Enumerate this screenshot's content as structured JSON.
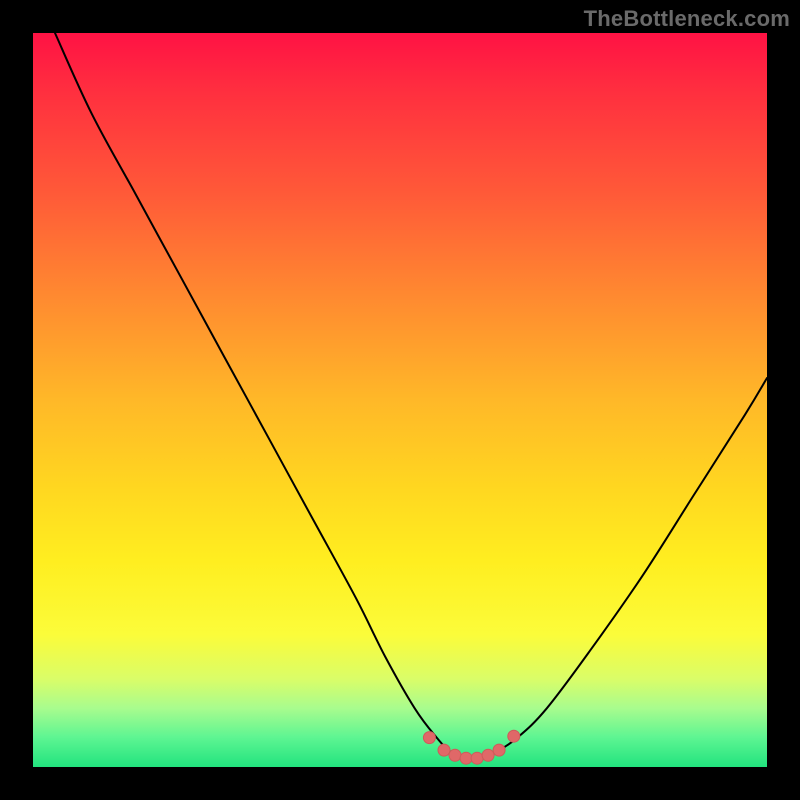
{
  "watermark": "TheBottleneck.com",
  "colors": {
    "curve": "#000000",
    "marker_fill": "#e06868",
    "marker_stroke": "#cf5a5a",
    "gradient_top": "#ff1244",
    "gradient_bottom": "#22e37e",
    "frame": "#000000"
  },
  "chart_data": {
    "type": "line",
    "title": "",
    "xlabel": "",
    "ylabel": "",
    "xlim": [
      0,
      100
    ],
    "ylim": [
      0,
      100
    ],
    "grid": false,
    "legend": null,
    "series": [
      {
        "name": "bottleneck-curve",
        "x": [
          3,
          8,
          14,
          20,
          26,
          32,
          38,
          44,
          48,
          52,
          55,
          57,
          59,
          61,
          63,
          66,
          70,
          76,
          83,
          90,
          97,
          100
        ],
        "y": [
          100,
          89,
          78,
          67,
          56,
          45,
          34,
          23,
          15,
          8,
          4,
          2,
          1.2,
          1.2,
          2,
          4,
          8,
          16,
          26,
          37,
          48,
          53
        ]
      }
    ],
    "markers": {
      "name": "trough-markers",
      "x": [
        54,
        56,
        57.5,
        59,
        60.5,
        62,
        63.5,
        65.5
      ],
      "y": [
        4.0,
        2.3,
        1.6,
        1.2,
        1.2,
        1.6,
        2.3,
        4.2
      ]
    }
  }
}
